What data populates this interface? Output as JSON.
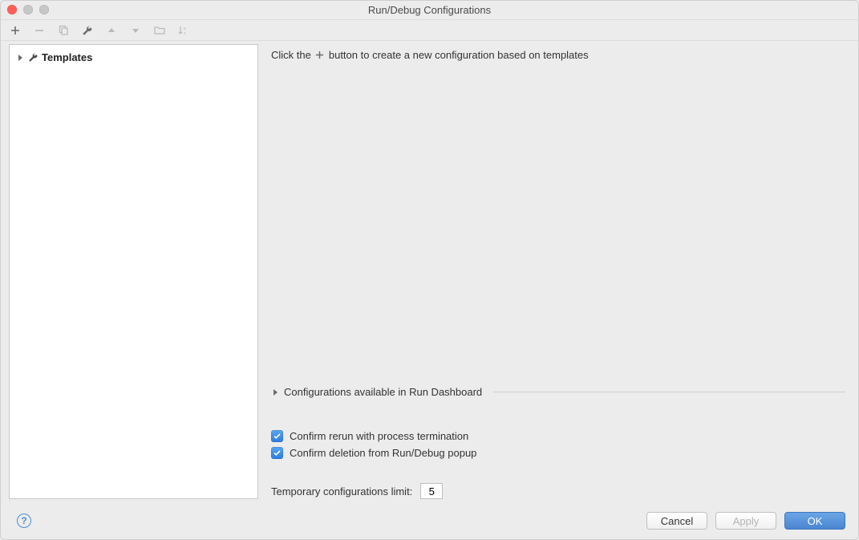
{
  "window": {
    "title": "Run/Debug Configurations"
  },
  "toolbar": {
    "add": "add",
    "remove": "remove",
    "copy": "copy",
    "edit": "edit",
    "up": "up",
    "down": "down",
    "folder": "folder",
    "sort": "sort"
  },
  "tree": {
    "templates_label": "Templates"
  },
  "content": {
    "hint_prefix": "Click the",
    "hint_suffix": "button to create a new configuration based on templates",
    "dashboard_section_label": "Configurations available in Run Dashboard",
    "confirm_rerun_label": "Confirm rerun with process termination",
    "confirm_delete_label": "Confirm deletion from Run/Debug popup",
    "temp_limit_label": "Temporary configurations limit:",
    "temp_limit_value": "5"
  },
  "footer": {
    "cancel_label": "Cancel",
    "apply_label": "Apply",
    "ok_label": "OK"
  }
}
